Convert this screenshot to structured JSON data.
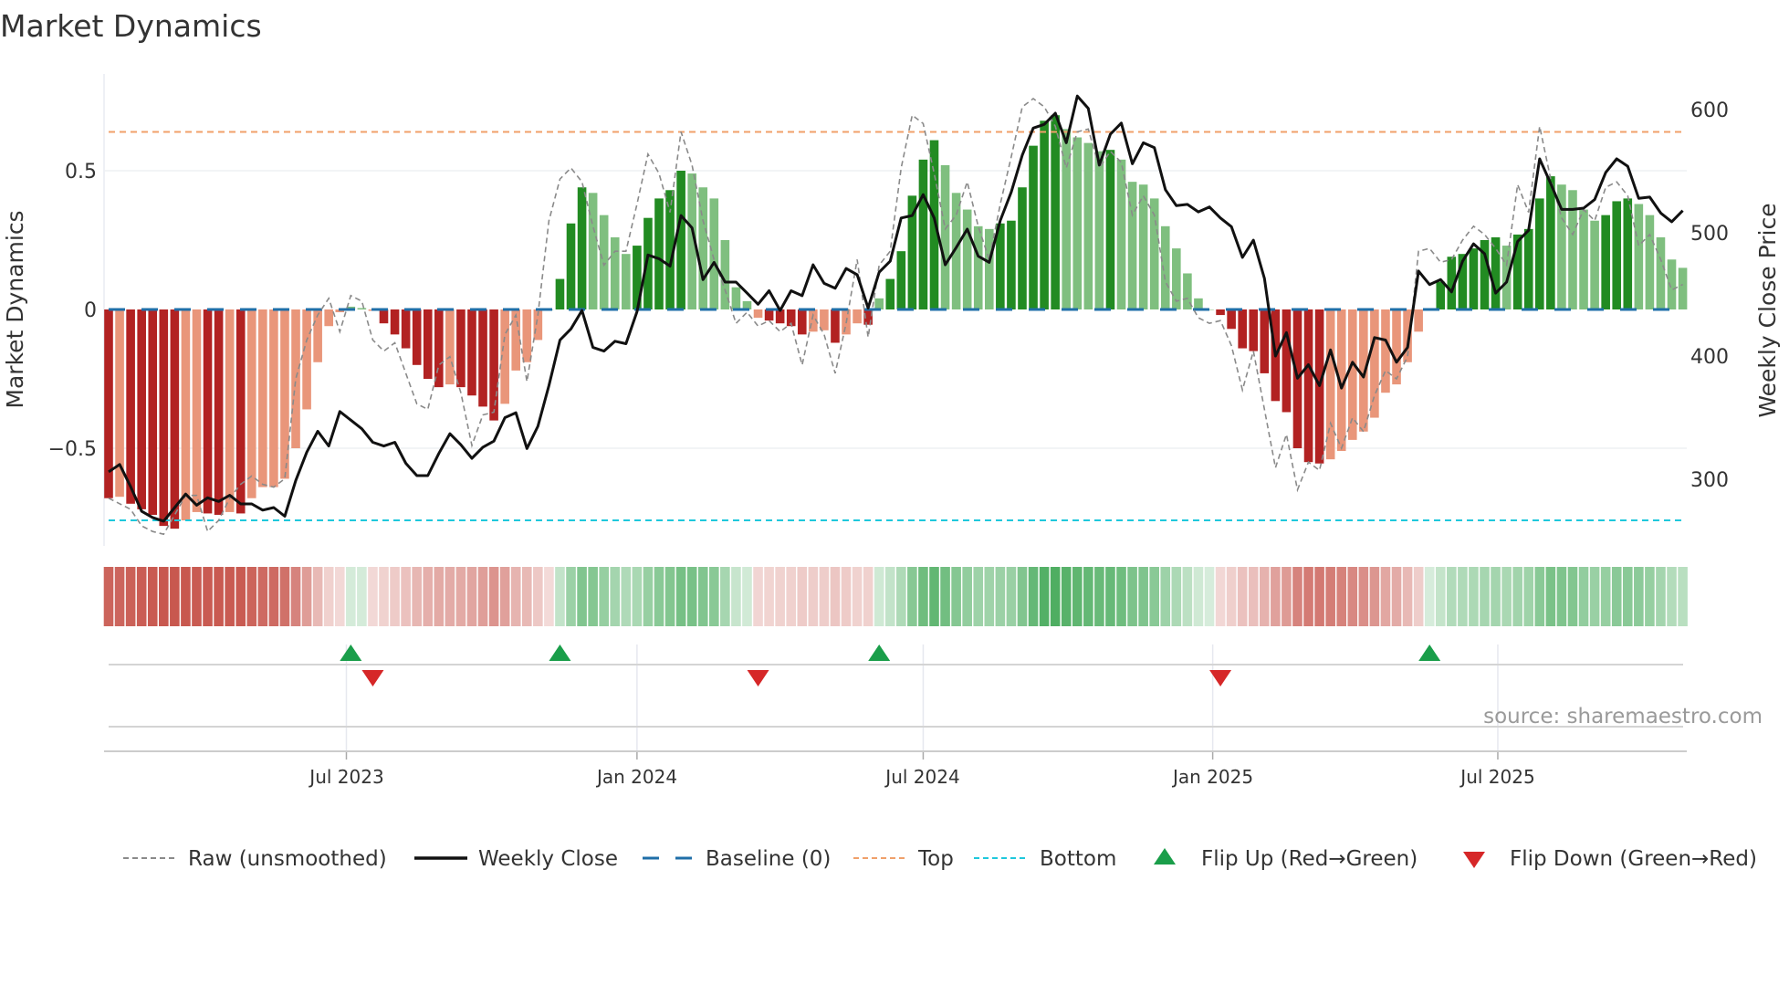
{
  "title": "Market Dynamics",
  "source": "source: sharemaestro.com",
  "legend": {
    "raw": "Raw (unsmoothed)",
    "close": "Weekly Close",
    "baseline": "Baseline (0)",
    "top": "Top",
    "bottom": "Bottom",
    "flip_up": "Flip Up (Red→Green)",
    "flip_down": "Flip Down (Green→Red)"
  },
  "colors": {
    "green_strong": "#228b22",
    "green_weak": "#7fbf7f",
    "red_strong": "#b22222",
    "red_weak": "#e9967a",
    "baseline": "#1f6fa8",
    "top": "#f0a06a",
    "bottom": "#1ec8dc",
    "raw": "#8a8a8a",
    "close": "#111111",
    "flip_up": "#1a9e4a",
    "flip_down": "#d62728",
    "strip_red": "#c8584f",
    "strip_green": "#46aa5a"
  },
  "chart_data": {
    "type": "bar",
    "title": "Market Dynamics",
    "ylabel": "Market Dynamics",
    "y2label": "Weekly Close Price",
    "ylim": [
      -0.87,
      0.85
    ],
    "y2lim": [
      227,
      628
    ],
    "yticks": [
      {
        "value": 0.5,
        "label": "0.5"
      },
      {
        "value": 0,
        "label": "0"
      },
      {
        "value": -0.5,
        "label": "−0.5"
      }
    ],
    "y2ticks": [
      {
        "value": 600,
        "label": "600"
      },
      {
        "value": 500,
        "label": "500"
      },
      {
        "value": 400,
        "label": "400"
      },
      {
        "value": 300,
        "label": "300"
      }
    ],
    "xticks": [
      {
        "week": 21.6,
        "label": "Jul 2023"
      },
      {
        "week": 48.0,
        "label": "Jan 2024"
      },
      {
        "week": 74.0,
        "label": "Jul 2024"
      },
      {
        "week": 100.3,
        "label": "Jan 2025"
      },
      {
        "week": 126.2,
        "label": "Jul 2025"
      }
    ],
    "top_level": 0.64,
    "bottom_level": -0.76,
    "baseline": 0,
    "dynamics": [
      -0.68,
      -0.675,
      -0.7,
      -0.72,
      -0.74,
      -0.78,
      -0.79,
      -0.76,
      -0.73,
      -0.735,
      -0.74,
      -0.73,
      -0.735,
      -0.68,
      -0.64,
      -0.64,
      -0.61,
      -0.5,
      -0.36,
      -0.19,
      -0.06,
      -0.01,
      0.01,
      0.005,
      -0.005,
      -0.05,
      -0.09,
      -0.14,
      -0.2,
      -0.25,
      -0.28,
      -0.27,
      -0.28,
      -0.31,
      -0.35,
      -0.4,
      -0.34,
      -0.22,
      -0.19,
      -0.11,
      0.0,
      0.11,
      0.31,
      0.44,
      0.42,
      0.34,
      0.26,
      0.2,
      0.23,
      0.33,
      0.4,
      0.43,
      0.5,
      0.49,
      0.44,
      0.4,
      0.25,
      0.08,
      0.03,
      -0.03,
      -0.04,
      -0.05,
      -0.06,
      -0.09,
      -0.08,
      -0.075,
      -0.12,
      -0.09,
      -0.05,
      -0.055,
      0.04,
      0.11,
      0.21,
      0.41,
      0.54,
      0.61,
      0.52,
      0.42,
      0.36,
      0.3,
      0.29,
      0.31,
      0.32,
      0.44,
      0.59,
      0.68,
      0.7,
      0.65,
      0.62,
      0.6,
      0.57,
      0.575,
      0.54,
      0.46,
      0.45,
      0.4,
      0.3,
      0.22,
      0.13,
      0.04,
      0.0,
      -0.02,
      -0.07,
      -0.14,
      -0.15,
      -0.23,
      -0.33,
      -0.37,
      -0.5,
      -0.55,
      -0.555,
      -0.54,
      -0.51,
      -0.47,
      -0.44,
      -0.39,
      -0.3,
      -0.27,
      -0.19,
      -0.08,
      0.0,
      0.1,
      0.19,
      0.2,
      0.22,
      0.25,
      0.26,
      0.23,
      0.27,
      0.29,
      0.4,
      0.48,
      0.45,
      0.43,
      0.36,
      0.32,
      0.34,
      0.39,
      0.4,
      0.38,
      0.34,
      0.26,
      0.18,
      0.15
    ],
    "raw": [
      -0.68,
      -0.7,
      -0.72,
      -0.78,
      -0.8,
      -0.81,
      -0.74,
      -0.67,
      -0.67,
      -0.8,
      -0.76,
      -0.68,
      -0.63,
      -0.6,
      -0.63,
      -0.64,
      -0.61,
      -0.25,
      -0.11,
      -0.02,
      0.04,
      -0.08,
      0.05,
      0.03,
      -0.11,
      -0.15,
      -0.12,
      -0.23,
      -0.34,
      -0.36,
      -0.2,
      -0.17,
      -0.3,
      -0.49,
      -0.38,
      -0.37,
      -0.09,
      -0.02,
      -0.26,
      -0.02,
      0.32,
      0.47,
      0.51,
      0.46,
      0.3,
      0.16,
      0.21,
      0.21,
      0.38,
      0.56,
      0.49,
      0.35,
      0.64,
      0.52,
      0.32,
      0.18,
      0.07,
      -0.05,
      -0.01,
      -0.06,
      -0.04,
      -0.08,
      -0.05,
      -0.2,
      -0.02,
      -0.09,
      -0.23,
      -0.05,
      0.18,
      -0.1,
      0.16,
      0.21,
      0.51,
      0.7,
      0.67,
      0.49,
      0.29,
      0.34,
      0.46,
      0.3,
      0.18,
      0.38,
      0.55,
      0.73,
      0.76,
      0.73,
      0.66,
      0.51,
      0.64,
      0.65,
      0.51,
      0.57,
      0.53,
      0.34,
      0.41,
      0.34,
      0.1,
      0.03,
      0.04,
      -0.03,
      -0.05,
      -0.04,
      -0.13,
      -0.29,
      -0.15,
      -0.36,
      -0.57,
      -0.45,
      -0.65,
      -0.55,
      -0.58,
      -0.41,
      -0.5,
      -0.39,
      -0.44,
      -0.31,
      -0.22,
      -0.25,
      -0.17,
      0.21,
      0.22,
      0.17,
      0.18,
      0.25,
      0.3,
      0.27,
      0.22,
      0.16,
      0.45,
      0.35,
      0.66,
      0.47,
      0.33,
      0.27,
      0.36,
      0.32,
      0.44,
      0.46,
      0.41,
      0.23,
      0.27,
      0.18,
      0.07,
      0.09
    ],
    "weekly_close": [
      306,
      312,
      294,
      274,
      269,
      266,
      277,
      288,
      279,
      285,
      282,
      287,
      280,
      280,
      275,
      277,
      270,
      299,
      322,
      339,
      327,
      355,
      348,
      341,
      330,
      327,
      330,
      313,
      303,
      303,
      321,
      337,
      328,
      317,
      326,
      331,
      350,
      354,
      325,
      343,
      376,
      413,
      422,
      437,
      407,
      404,
      412,
      410,
      436,
      482,
      479,
      473,
      514,
      504,
      462,
      476,
      460,
      460,
      451,
      442,
      453,
      437,
      453,
      449,
      474,
      459,
      455,
      471,
      466,
      439,
      468,
      477,
      512,
      514,
      531,
      512,
      474,
      488,
      503,
      481,
      476,
      510,
      533,
      563,
      585,
      588,
      597,
      573,
      611,
      601,
      555,
      580,
      589,
      556,
      573,
      569,
      535,
      522,
      523,
      517,
      521,
      512,
      505,
      480,
      494,
      463,
      400,
      419,
      382,
      393,
      376,
      405,
      374,
      395,
      383,
      415,
      413,
      395,
      407,
      469,
      458,
      462,
      452,
      477,
      491,
      483,
      451,
      460,
      493,
      502,
      560,
      540,
      519,
      519,
      520,
      527,
      549,
      560,
      554,
      528,
      529,
      516,
      509,
      518
    ],
    "flip_up_weeks": [
      22,
      41,
      70,
      120
    ],
    "flip_down_weeks": [
      24,
      59,
      101
    ],
    "initial_regime": "red",
    "grid": true,
    "legend_position": "bottom"
  }
}
